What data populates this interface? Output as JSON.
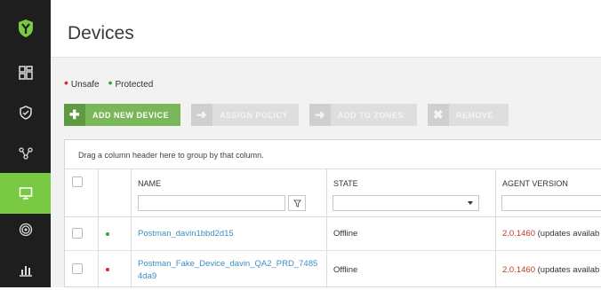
{
  "colors": {
    "accent": "#7ac943",
    "sidebar_bg": "#1e1e1e",
    "unsafe": "#e02424",
    "protected": "#2ea043",
    "link": "#3a8fc1",
    "version": "#c0392b"
  },
  "sidebar": {
    "logo_icon": "shield-logo-icon",
    "items": [
      {
        "icon": "dashboard-icon",
        "active": false
      },
      {
        "icon": "shield-alert-icon",
        "active": false
      },
      {
        "icon": "network-icon",
        "active": false
      },
      {
        "icon": "monitor-icon",
        "active": true
      },
      {
        "icon": "radar-icon",
        "active": false
      },
      {
        "icon": "bar-chart-icon",
        "active": false
      }
    ]
  },
  "header": {
    "title": "Devices"
  },
  "legend": {
    "unsafe": "Unsafe",
    "protected": "Protected"
  },
  "toolbar": {
    "add": "ADD NEW DEVICE",
    "assign": "ASSIGN POLICY",
    "zones": "ADD TO ZONES",
    "remove": "REMOVE"
  },
  "grid": {
    "group_hint": "Drag a column header here to group by that column.",
    "columns": {
      "name": "NAME",
      "state": "STATE",
      "agent_version": "AGENT VERSION"
    },
    "rows": [
      {
        "status": "protected",
        "name_line1": "Postman_davin1bbd2d15",
        "name_line2": "",
        "state": "Offline",
        "version": "2.0.1460",
        "version_note": "(updates availab"
      },
      {
        "status": "unsafe",
        "name_line1": "Postman_Fake_Device_davin_QA2_PRD_7485",
        "name_line2": "4da9",
        "state": "Offline",
        "version": "2.0.1460",
        "version_note": "(updates availab"
      }
    ]
  }
}
